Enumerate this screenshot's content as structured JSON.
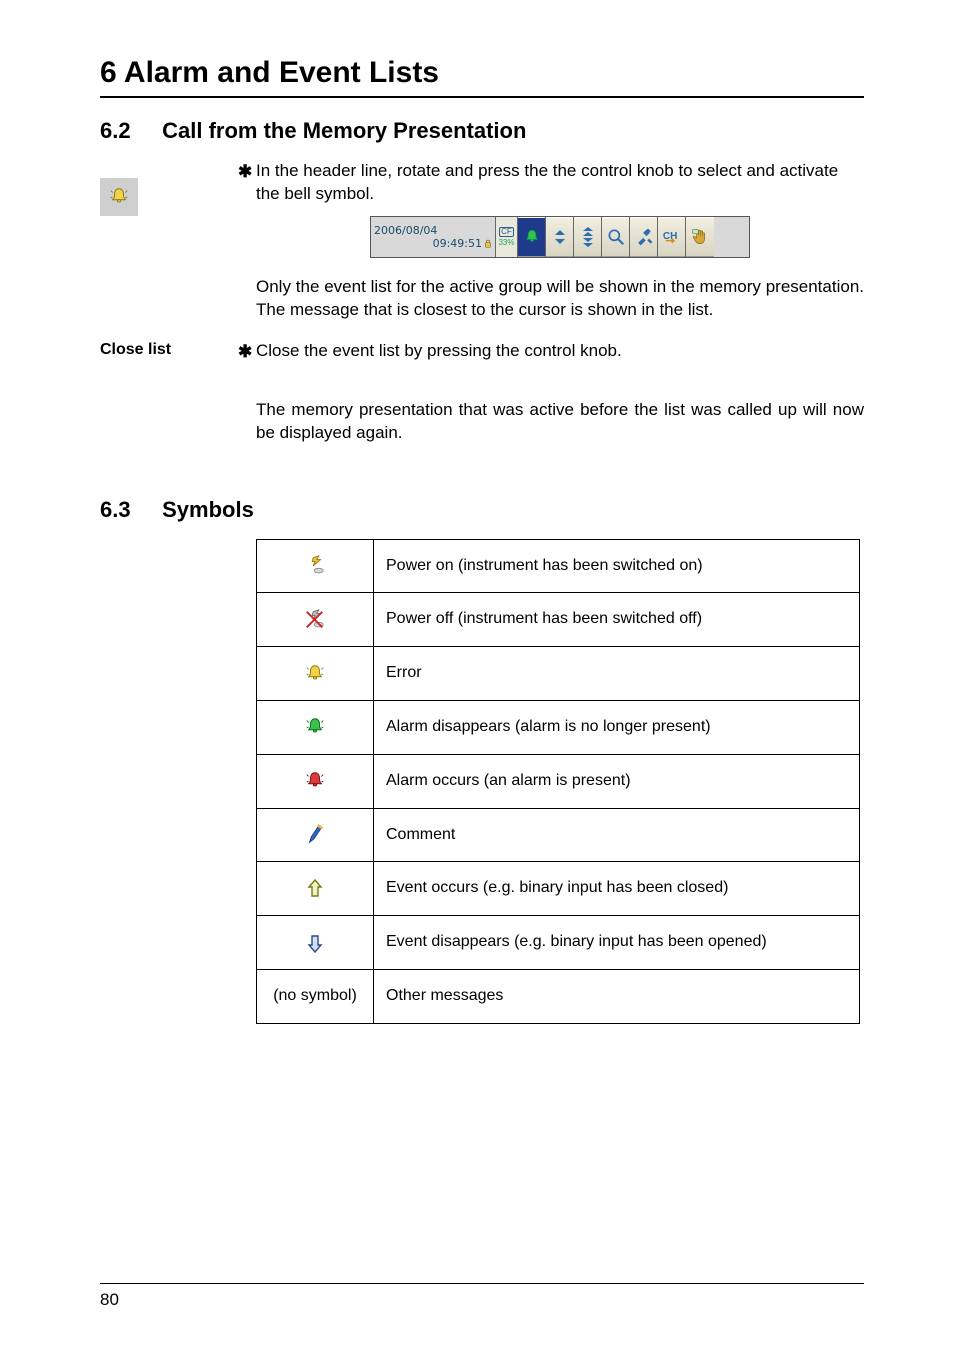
{
  "chapter_title": "6 Alarm and Event Lists",
  "section62": {
    "num": "6.2",
    "title": "Call from the Memory Presentation",
    "step1": "In the header line, rotate and press the the control knob to select and activate the bell symbol.",
    "note_after_toolbar": "Only the event list for the active group will be shown in the memory presentation. The message that is closest to the cursor is shown in the list.",
    "close_label": "Close list",
    "close_step": "Close the event list by pressing the control knob.",
    "close_note": "The memory presentation that was active before the list was called up will now be displayed again."
  },
  "toolbar": {
    "date": "2006/08/04",
    "time": "09:49:51",
    "cf_label": "CF",
    "cf_pct": "33%",
    "icons": [
      "bell-icon",
      "updown-small-icon",
      "updown-large-icon",
      "search-icon",
      "tools-icon",
      "ch-icon",
      "hand-icon"
    ]
  },
  "section63": {
    "num": "6.3",
    "title": "Symbols",
    "rows": [
      {
        "icon": "power-on-icon",
        "text": "Power on (instrument has been switched on)"
      },
      {
        "icon": "power-off-icon",
        "text": "Power off (instrument has been switched off)"
      },
      {
        "icon": "bell-yellow-icon",
        "text": "Error"
      },
      {
        "icon": "bell-green-icon",
        "text": "Alarm disappears (alarm is no longer present)"
      },
      {
        "icon": "bell-red-icon",
        "text": "Alarm occurs (an alarm is present)"
      },
      {
        "icon": "pen-icon",
        "text": "Comment"
      },
      {
        "icon": "arrow-up-icon",
        "text": "Event occurs (e.g. binary input has been closed)"
      },
      {
        "icon": "arrow-down-icon",
        "text": "Event disappears (e.g. binary input has been opened)"
      },
      {
        "icon": "no-symbol",
        "text": "Other messages"
      }
    ],
    "no_symbol_label": "(no symbol)"
  },
  "page_number": "80"
}
